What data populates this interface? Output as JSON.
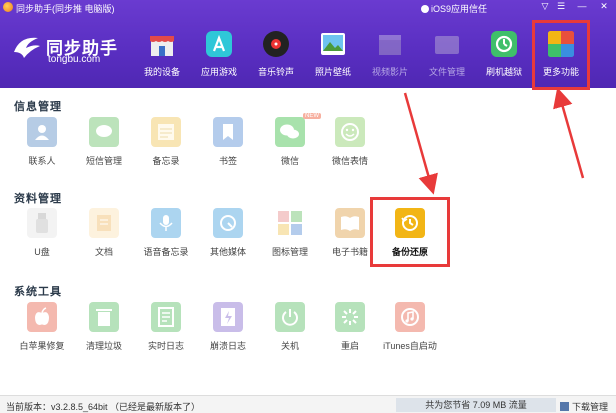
{
  "window": {
    "title": "同步助手(同步推 电脑版)",
    "ios_trust": "iOS9应用信任",
    "controls": [
      "▽",
      "☰",
      "—",
      "✕"
    ]
  },
  "brand": {
    "name": "同步助手",
    "url": "tongbu.com"
  },
  "nav": [
    {
      "label": "我的设备",
      "icon": "store-icon"
    },
    {
      "label": "应用游戏",
      "icon": "app-store-icon"
    },
    {
      "label": "音乐铃声",
      "icon": "music-disc-icon"
    },
    {
      "label": "照片壁纸",
      "icon": "photo-icon"
    },
    {
      "label": "视频影片",
      "icon": "clapper-icon"
    },
    {
      "label": "文件管理",
      "icon": "folder-icon"
    },
    {
      "label": "刷机越狱",
      "icon": "refresh-icon"
    },
    {
      "label": "更多功能",
      "icon": "tiles-icon"
    }
  ],
  "sections": {
    "info": {
      "title": "信息管理",
      "items": [
        {
          "label": "联系人",
          "icon": "contact-icon",
          "color": "#5f8fc6"
        },
        {
          "label": "短信管理",
          "icon": "sms-icon",
          "color": "#6dc26a"
        },
        {
          "label": "备忘录",
          "icon": "memo-icon",
          "color": "#f1c75a"
        },
        {
          "label": "书签",
          "icon": "bookmark-icon",
          "color": "#5a8fd6"
        },
        {
          "label": "微信",
          "icon": "wechat-icon",
          "color": "#3fbf4a",
          "badge": "NEW"
        },
        {
          "label": "微信表情",
          "icon": "emoji-icon",
          "color": "#8ed06a"
        }
      ]
    },
    "data": {
      "title": "资料管理",
      "items": [
        {
          "label": "U盘",
          "icon": "usb-icon",
          "color": "#b9b9b9"
        },
        {
          "label": "文档",
          "icon": "document-icon",
          "color": "#f1bc6a"
        },
        {
          "label": "语音备忘录",
          "icon": "microphone-icon",
          "color": "#4aa3e0"
        },
        {
          "label": "其他媒体",
          "icon": "media-icon",
          "color": "#4aa3e0"
        },
        {
          "label": "图标管理",
          "icon": "icon-grid-icon",
          "color": "#e88d8d"
        },
        {
          "label": "电子书籍",
          "icon": "book-icon",
          "color": "#e0a24a"
        },
        {
          "label": "备份还原",
          "icon": "backup-icon",
          "color": "#f2b515"
        }
      ]
    },
    "system": {
      "title": "系统工具",
      "items": [
        {
          "label": "白苹果修复",
          "icon": "apple-icon",
          "color": "#e8654f"
        },
        {
          "label": "清理垃圾",
          "icon": "trash-icon",
          "color": "#5fbf6a"
        },
        {
          "label": "实时日志",
          "icon": "log-icon",
          "color": "#5fbf6a"
        },
        {
          "label": "崩溃日志",
          "icon": "crash-log-icon",
          "color": "#8a6fd0"
        },
        {
          "label": "关机",
          "icon": "power-icon",
          "color": "#5fbf6a"
        },
        {
          "label": "重启",
          "icon": "restart-icon",
          "color": "#5fbf6a"
        },
        {
          "label": "iTunes自启动",
          "icon": "itunes-icon",
          "color": "#e8654f"
        }
      ]
    }
  },
  "status": {
    "version": "当前版本：v3.2.8.5_64bit （已经是最新版本了）",
    "saved": "共为您节省  7.09 MB 流量",
    "download": "下载管理"
  },
  "colors": {
    "header": "#5a2fc2",
    "highlight": "#e83a3a",
    "accent_gold": "#f2b515"
  }
}
